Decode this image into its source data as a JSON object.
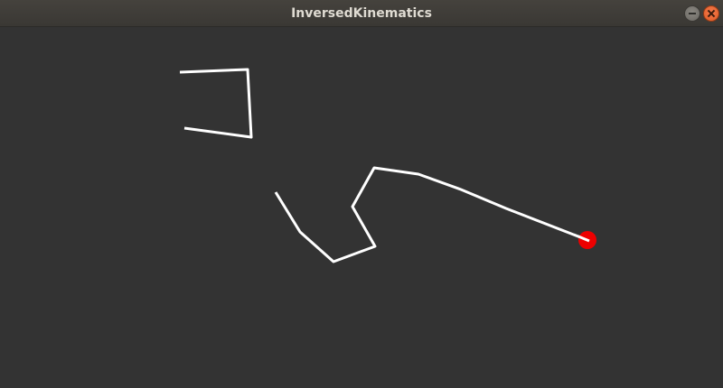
{
  "window": {
    "title": "InversedKinematics"
  },
  "colors": {
    "background": "#333333",
    "segment": "#ffffff",
    "target": "#ee0000"
  },
  "icons": {
    "minimize": "minimize-icon",
    "close": "close-icon"
  }
}
